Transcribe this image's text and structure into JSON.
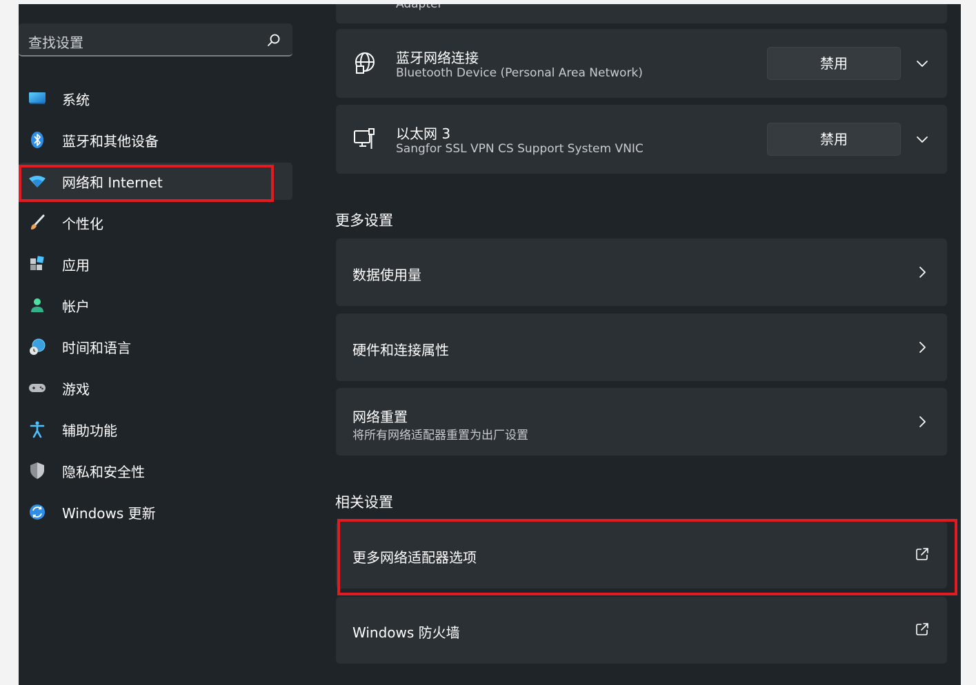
{
  "sidebar": {
    "search_placeholder": "查找设置",
    "items": [
      {
        "label": "系统",
        "icon": "monitor-icon"
      },
      {
        "label": "蓝牙和其他设备",
        "icon": "bluetooth-icon"
      },
      {
        "label": "网络和 Internet",
        "icon": "wifi-icon",
        "active": true
      },
      {
        "label": "个性化",
        "icon": "brush-icon"
      },
      {
        "label": "应用",
        "icon": "apps-icon"
      },
      {
        "label": "帐户",
        "icon": "account-icon"
      },
      {
        "label": "时间和语言",
        "icon": "globe-clock-icon"
      },
      {
        "label": "游戏",
        "icon": "gamepad-icon"
      },
      {
        "label": "辅助功能",
        "icon": "accessibility-icon"
      },
      {
        "label": "隐私和安全性",
        "icon": "shield-icon"
      },
      {
        "label": "Windows 更新",
        "icon": "update-icon"
      }
    ]
  },
  "main": {
    "partial_top_text": "Adapter",
    "adapters": [
      {
        "name": "蓝牙网络连接",
        "description": "Bluetooth Device (Personal Area Network)",
        "button": "禁用",
        "icon": "globe-network-icon"
      },
      {
        "name": "以太网 3",
        "description": "Sangfor SSL VPN CS Support System VNIC",
        "button": "禁用",
        "icon": "ethernet-icon"
      }
    ],
    "more_settings": {
      "title": "更多设置",
      "items": [
        {
          "title": "数据使用量"
        },
        {
          "title": "硬件和连接属性"
        },
        {
          "title": "网络重置",
          "subtitle": "将所有网络适配器重置为出厂设置"
        }
      ]
    },
    "related_settings": {
      "title": "相关设置",
      "items": [
        {
          "title": "更多网络适配器选项"
        },
        {
          "title": "Windows 防火墙"
        }
      ]
    }
  },
  "colors": {
    "accent": "#4cc2ff",
    "highlight": "#e11b22",
    "background": "#1f2428",
    "card": "#2b3034"
  }
}
